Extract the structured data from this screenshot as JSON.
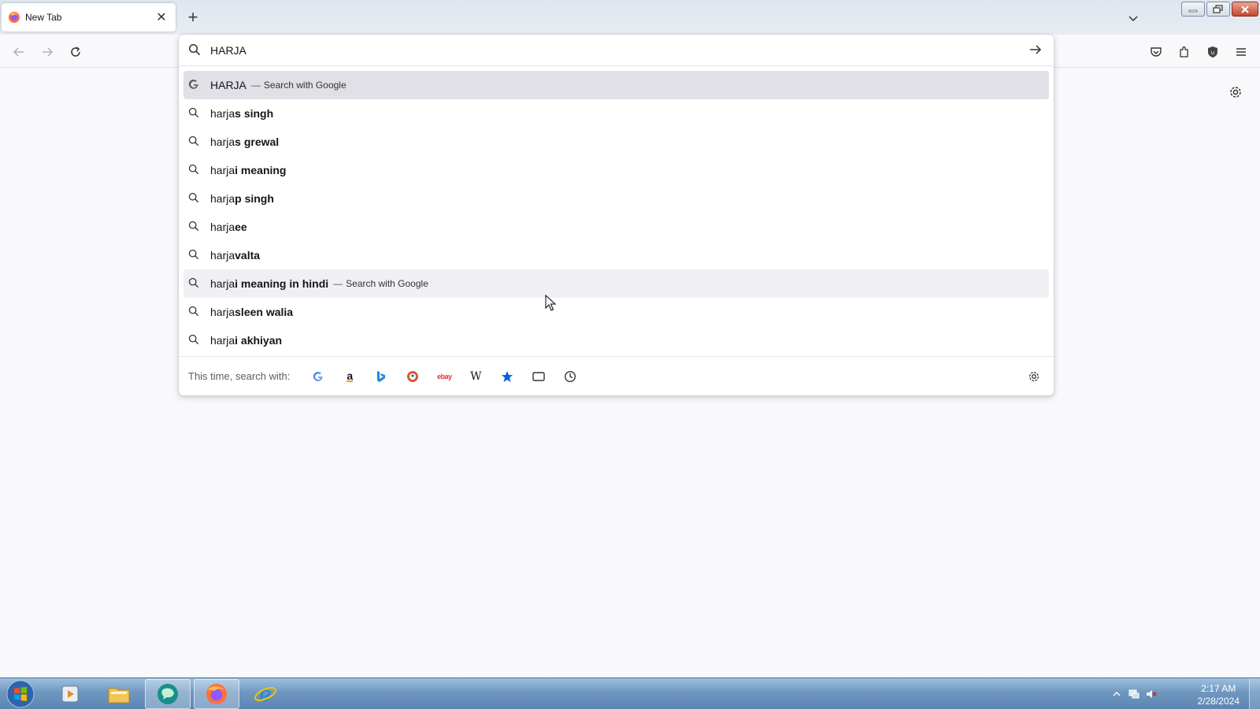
{
  "browser": {
    "tab": {
      "title": "New Tab",
      "close": "✕"
    },
    "new_tab": "+",
    "url_input": {
      "value": "HARJA"
    }
  },
  "dropdown": {
    "rows": [
      {
        "typed": "HARJA",
        "suffix": "",
        "dash": "—",
        "action": "Search with Google",
        "icon": "google-icon",
        "state": "selected"
      },
      {
        "typed": "harja",
        "suffix": "s singh",
        "icon": "search-icon"
      },
      {
        "typed": "harja",
        "suffix": "s grewal",
        "icon": "search-icon"
      },
      {
        "typed": "harja",
        "suffix": "i meaning",
        "icon": "search-icon"
      },
      {
        "typed": "harja",
        "suffix": "p singh",
        "icon": "search-icon"
      },
      {
        "typed": "harja",
        "suffix": "ee",
        "icon": "search-icon"
      },
      {
        "typed": "harja",
        "suffix": "valta",
        "icon": "search-icon"
      },
      {
        "typed": "harja",
        "suffix": "i meaning in hindi",
        "dash": "—",
        "action": "Search with Google",
        "icon": "search-icon",
        "state": "hovered"
      },
      {
        "typed": "harja",
        "suffix": "sleen walia",
        "icon": "search-icon"
      },
      {
        "typed": "harja",
        "suffix": "i akhiyan",
        "icon": "search-icon"
      }
    ],
    "one_off": {
      "label": "This time, search with:",
      "engines": [
        "google-icon",
        "amazon-icon",
        "bing-icon",
        "duckduckgo-icon",
        "ebay-icon",
        "wikipedia-icon",
        "bookmarks-icon",
        "tabs-icon",
        "history-icon"
      ],
      "ebay_text": "ebay",
      "amazon_text": "a",
      "wiki_text": "W"
    }
  },
  "taskbar": {
    "apps": [
      "media-player-icon",
      "file-explorer-icon",
      "app-icon",
      "firefox-icon",
      "internet-explorer-icon"
    ],
    "clock": {
      "time": "2:17 AM",
      "date": "2/28/2024"
    }
  },
  "colors": {
    "accent": "#0061e0",
    "selected_row": "#e0e0e6",
    "taskbar": "#6f97c0"
  }
}
